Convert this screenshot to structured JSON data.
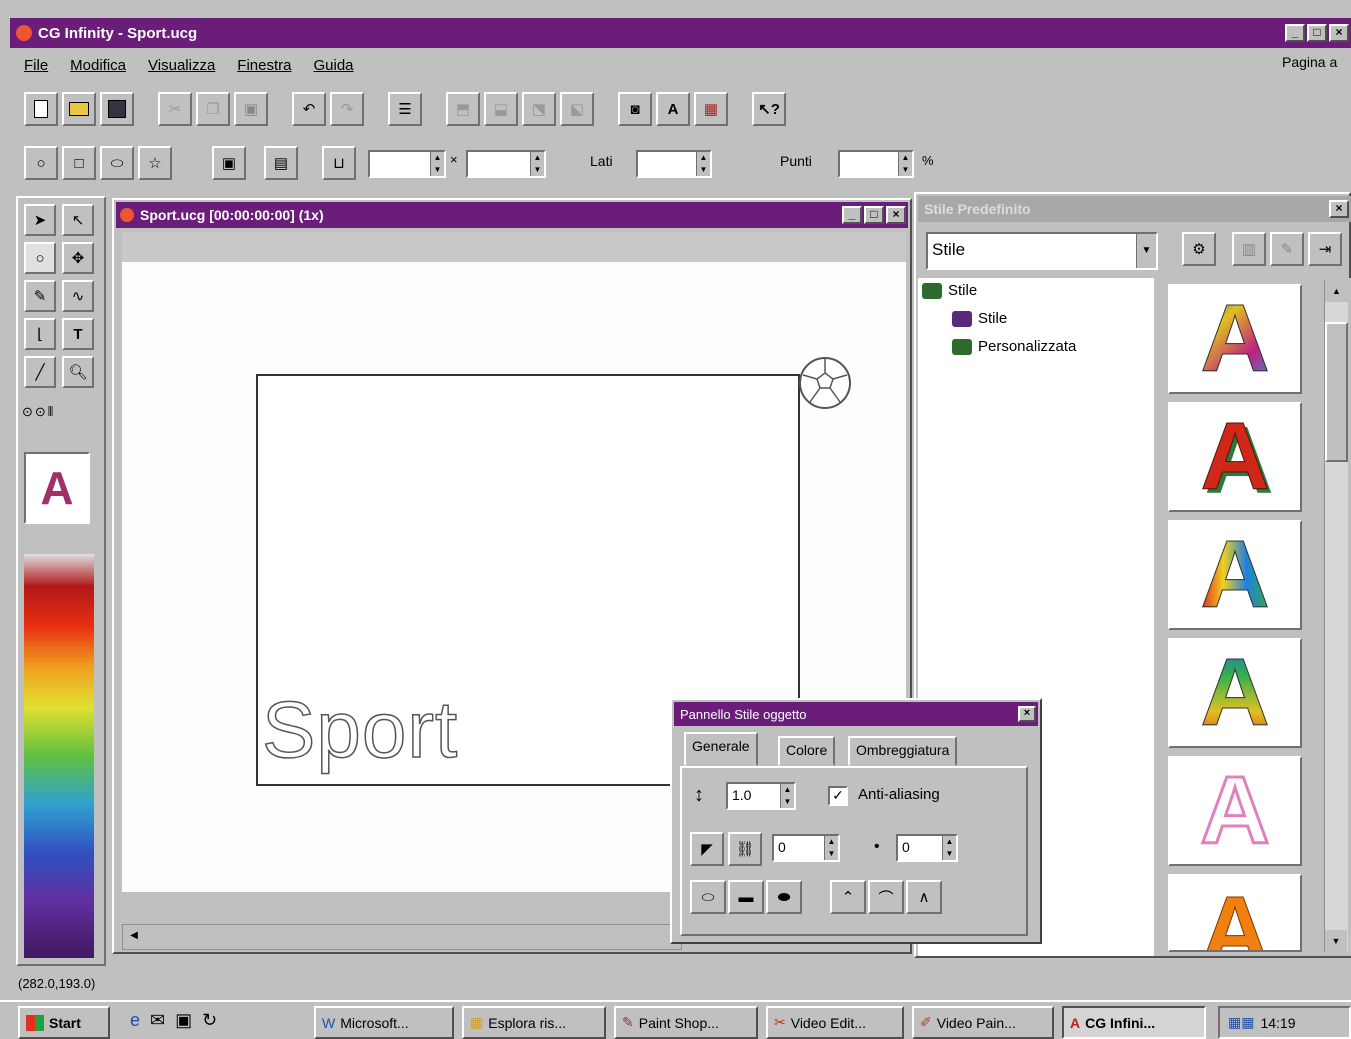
{
  "app": {
    "title": "CG Infinity - Sport.ucg",
    "right_label": "Pagina a"
  },
  "menu": [
    "File",
    "Modifica",
    "Visualizza",
    "Finestra",
    "Guida"
  ],
  "shape_toolbar": {
    "lati_label": "Lati",
    "punti_label": "Punti",
    "percent": "%"
  },
  "document": {
    "title": "Sport.ucg [00:00:00:00] (1x)",
    "text_object": "Sport"
  },
  "styles_panel": {
    "title": "Stile Predefinito",
    "dropdown_value": "Stile",
    "tree": [
      {
        "label": "Stile",
        "level": 0
      },
      {
        "label": "Stile",
        "level": 1
      },
      {
        "label": "Personalizzata",
        "level": 1
      }
    ],
    "thumbnail_letter": "A",
    "thumbnail_styles": [
      "rainbow-3d",
      "red-3d",
      "multicolor-3d",
      "gradient-3d",
      "pink-outline",
      "orange-3d"
    ]
  },
  "props_panel": {
    "title": "Pannello Stile oggetto",
    "tabs": [
      "Generale",
      "Colore",
      "Ombreggiatura"
    ],
    "size_value": "1.0",
    "antialias_label": "Anti-aliasing",
    "antialias_checked": true,
    "offset_x": "0",
    "offset_y": "0"
  },
  "toolbox": {
    "preview_letter": "A"
  },
  "status": {
    "coords": "(282.0,193.0)"
  },
  "taskbar": {
    "start": "Start",
    "tasks": [
      "Microsoft...",
      "Esplora ris...",
      "Paint Shop...",
      "Video Edit...",
      "Video Pain...",
      "CG Infini..."
    ],
    "clock": "14:19"
  },
  "colors": {
    "titlebar": "#6b1d7a",
    "face": "#c0c0c0"
  }
}
